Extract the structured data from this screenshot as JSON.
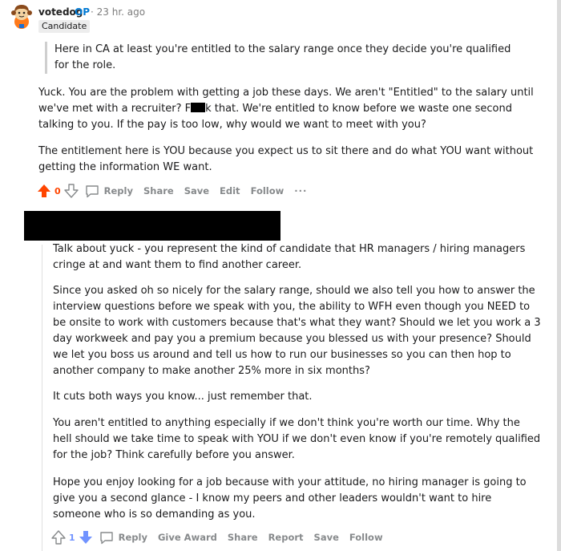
{
  "comment1": {
    "username": "votedog",
    "op_badge": "OP",
    "time": "· 23 hr. ago",
    "flair": "Candidate",
    "quote": "Here in CA at least you're entitled to the salary range once they decide you're qualified for the role.",
    "p1_a": "Yuck. You are the problem with getting a job these days. We aren't \"Entitled\" to the salary until we've met with a recruiter? F",
    "p1_b": "k that. We're entitled to know before we waste one second talking to you. If the pay is too low, why would we want to meet with you?",
    "p2": "The entitlement here is YOU because you expect us to sit there and do what YOU want without getting the information WE want.",
    "score": "0",
    "actions": {
      "reply": "Reply",
      "share": "Share",
      "save": "Save",
      "edit": "Edit",
      "follow": "Follow",
      "more": "···"
    }
  },
  "comment2": {
    "p1": "Talk about yuck - you represent the kind of candidate that HR managers / hiring managers cringe at and want them to find another career.",
    "p2": "Since you asked oh so nicely for the salary range, should we also tell you how to answer the interview questions before we speak with you, the ability to WFH even though you NEED to be onsite to work with customers because that's what they want? Should we let you work a 3 day workweek and pay you a premium because you blessed us with your presence? Should we let you boss us around and tell us how to run our businesses so you can then hop to another company to make another 25% more in six months?",
    "p3": "It cuts both ways you know... just remember that.",
    "p4": "You aren't entitled to anything especially if we don't think you're worth our time. Why the hell should we take time to speak with YOU if we don't even know if you're remotely qualified for the job? Think carefully before you answer.",
    "p5": "Hope you enjoy looking for a job because with your attitude, no hiring manager is going to give you a second glance - I know my peers and other leaders wouldn't want to hire someone who is so demanding as you.",
    "score": "1",
    "actions": {
      "reply": "Reply",
      "give_award": "Give Award",
      "share": "Share",
      "report": "Report",
      "save": "Save",
      "follow": "Follow"
    }
  },
  "colors": {
    "upvote": "#ff4500",
    "downvote": "#7193ff",
    "op": "#0079d3",
    "meta": "#878a8c"
  }
}
